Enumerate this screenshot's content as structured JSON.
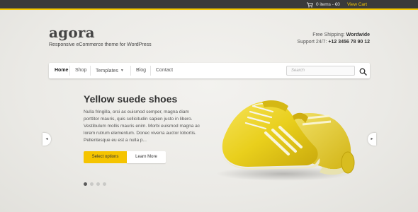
{
  "topbar": {
    "cart_text": "0 items - €0",
    "view_cart": "View Cart",
    "accent": "#f2c600"
  },
  "header": {
    "logo": "agora",
    "tagline": "Responsive eCommerce theme for WordPress",
    "shipping_label": "Free Shipping:",
    "shipping_value": "Wordwide",
    "support_label": "Support 24/7:",
    "support_value": "+12 3456 78 90 12"
  },
  "nav": {
    "items": [
      {
        "label": "Home",
        "active": true
      },
      {
        "label": "Shop"
      },
      {
        "label": "Templates",
        "has_dropdown": true
      },
      {
        "label": "Blog"
      },
      {
        "label": "Contact"
      }
    ],
    "search_placeholder": "Search",
    "search_icon": "search-icon"
  },
  "slide": {
    "title": "Yellow suede shoes",
    "text": "Nulla fringilla, orci ac euismod semper, magna diam porttitor mauris, quis sollicitudin sapien justo in libero. Vestibulum mollis mauris enim. Morbi euismod magna ac lorem rutrum elementum. Donec viverra auctor lobortis. Pellentesque eu est a nulla p...",
    "primary_button": "Select options",
    "secondary_button": "Learn More",
    "prev_arrow": "◂",
    "next_arrow": "▸",
    "image": "yellow-sneakers",
    "dot_count": 4,
    "active_dot": 1
  },
  "colors": {
    "accent": "#f5c400",
    "topbar": "#3a3a3a"
  }
}
